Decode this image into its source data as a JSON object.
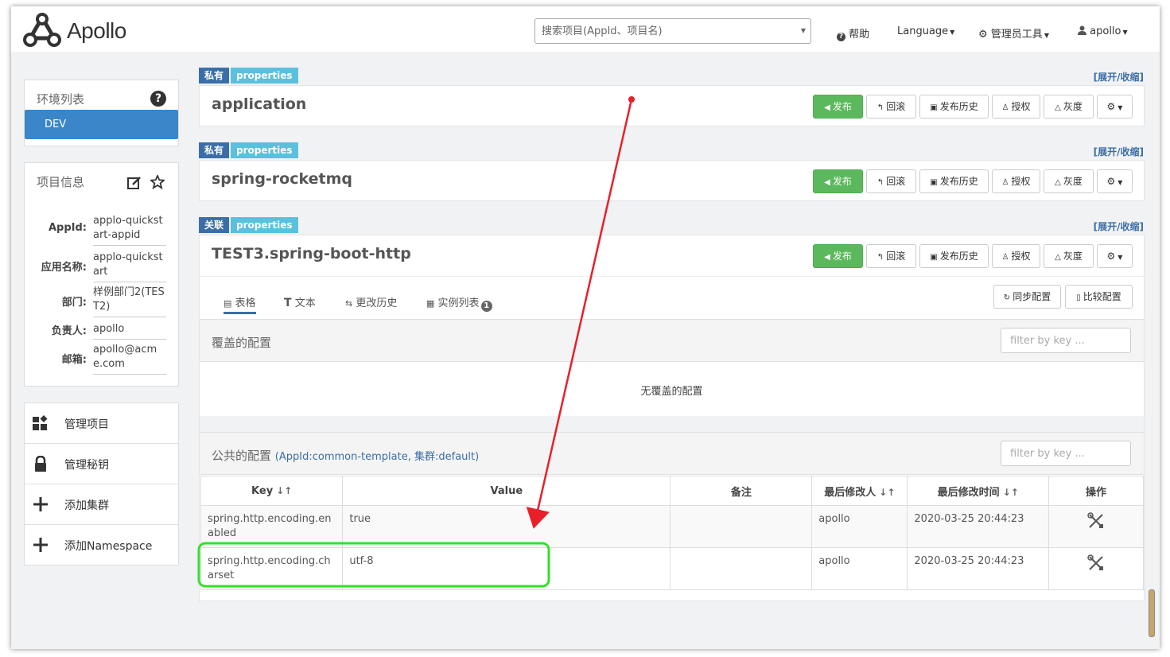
{
  "header": {
    "app_name": "Apollo",
    "search_placeholder": "搜索项目(AppId、项目名)",
    "help_label": "帮助",
    "language_label": "Language",
    "admin_tools_label": "管理员工具",
    "user_label": "apollo"
  },
  "sidebar": {
    "env_title": "环境列表",
    "env_selected": "DEV",
    "project_title": "项目信息",
    "info": [
      {
        "label": "AppId:",
        "value": "applo-quickstart-appid"
      },
      {
        "label": "应用名称:",
        "value": "applo-quickstart"
      },
      {
        "label": "部门:",
        "value": "样例部门2(TEST2)"
      },
      {
        "label": "负责人:",
        "value": "apollo"
      },
      {
        "label": "邮箱:",
        "value": "apollo@acme.com"
      }
    ],
    "menu": [
      {
        "label": "管理项目"
      },
      {
        "label": "管理秘钥"
      },
      {
        "label": "添加集群"
      },
      {
        "label": "添加Namespace"
      }
    ]
  },
  "namespaces": [
    {
      "scope": "私有",
      "format": "properties",
      "name": "application"
    },
    {
      "scope": "私有",
      "format": "properties",
      "name": "spring-rocketmq"
    },
    {
      "scope": "关联",
      "format": "properties",
      "name": "TEST3.spring-boot-http"
    }
  ],
  "common": {
    "expand_label": "[展开/收缩]",
    "publish": "发布",
    "rollback": "回滚",
    "history": "发布历史",
    "authorize": "授权",
    "gray": "灰度",
    "sync": "同步配置",
    "compare": "比较配置",
    "filter_placeholder": "filter by key ..."
  },
  "tabs": [
    {
      "label": "表格"
    },
    {
      "label": "文本"
    },
    {
      "label": "更改历史"
    },
    {
      "label": "实例列表",
      "badge": "1"
    }
  ],
  "override_section": {
    "title": "覆盖的配置",
    "empty_text": "无覆盖的配置"
  },
  "public_section": {
    "title": "公共的配置",
    "subtitle": "(AppId:common-template, 集群:default)",
    "columns": [
      "Key",
      "Value",
      "备注",
      "最后修改人",
      "最后修改时间",
      "操作"
    ],
    "rows": [
      {
        "key": "spring.http.encoding.enabled",
        "value": "true",
        "comment": "",
        "modifier": "apollo",
        "time": "2020-03-25 20:44:23"
      },
      {
        "key": "spring.http.encoding.charset",
        "value": "utf-8",
        "comment": "",
        "modifier": "apollo",
        "time": "2020-03-25 20:44:23"
      }
    ]
  },
  "annotation_colors": {
    "arrow": "#e8202a",
    "highlight": "#33e02a"
  }
}
